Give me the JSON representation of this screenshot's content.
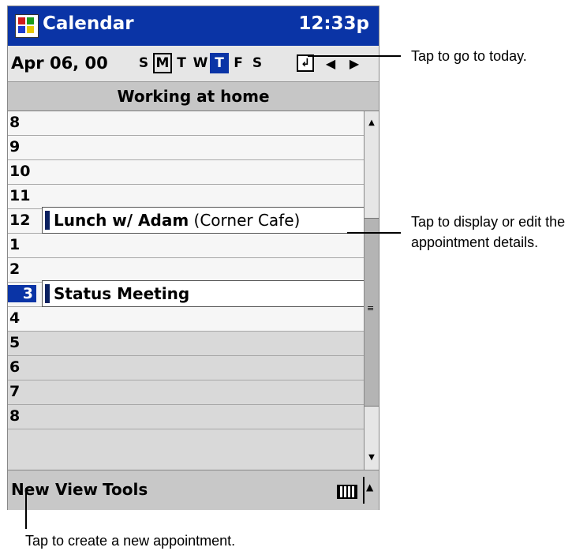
{
  "titlebar": {
    "app_name": "Calendar",
    "time": "12:33p"
  },
  "datebar": {
    "date": "Apr 06, 00",
    "days": [
      "S",
      "M",
      "T",
      "W",
      "T",
      "F",
      "S"
    ],
    "current_day_index": 1,
    "selected_day_index": 4,
    "today_glyph": "↲",
    "prev_glyph": "◀",
    "next_glyph": "▶"
  },
  "banner": "Working at home",
  "schedule": {
    "rows": [
      {
        "hour": "8"
      },
      {
        "hour": "9"
      },
      {
        "hour": "10"
      },
      {
        "hour": "11"
      },
      {
        "hour": "12"
      },
      {
        "hour": "1"
      },
      {
        "hour": "2"
      },
      {
        "hour": "3"
      },
      {
        "hour": "4"
      },
      {
        "hour": "5"
      },
      {
        "hour": "6"
      },
      {
        "hour": "7"
      },
      {
        "hour": "8"
      }
    ],
    "appointments": [
      {
        "hour": "12",
        "title": "Lunch w/ Adam",
        "location": "(Corner Cafe)"
      },
      {
        "hour": "3",
        "title": "Status Meeting",
        "location": ""
      }
    ]
  },
  "menubar": {
    "new": "New",
    "view": "View",
    "tools": "Tools"
  },
  "annotations": {
    "today": "Tap to go to today.",
    "details": "Tap to display or edit the appointment details.",
    "new": "Tap to create a new appointment."
  },
  "colors": {
    "accent": "#0a34a6",
    "event_bar": "#0a2060"
  }
}
